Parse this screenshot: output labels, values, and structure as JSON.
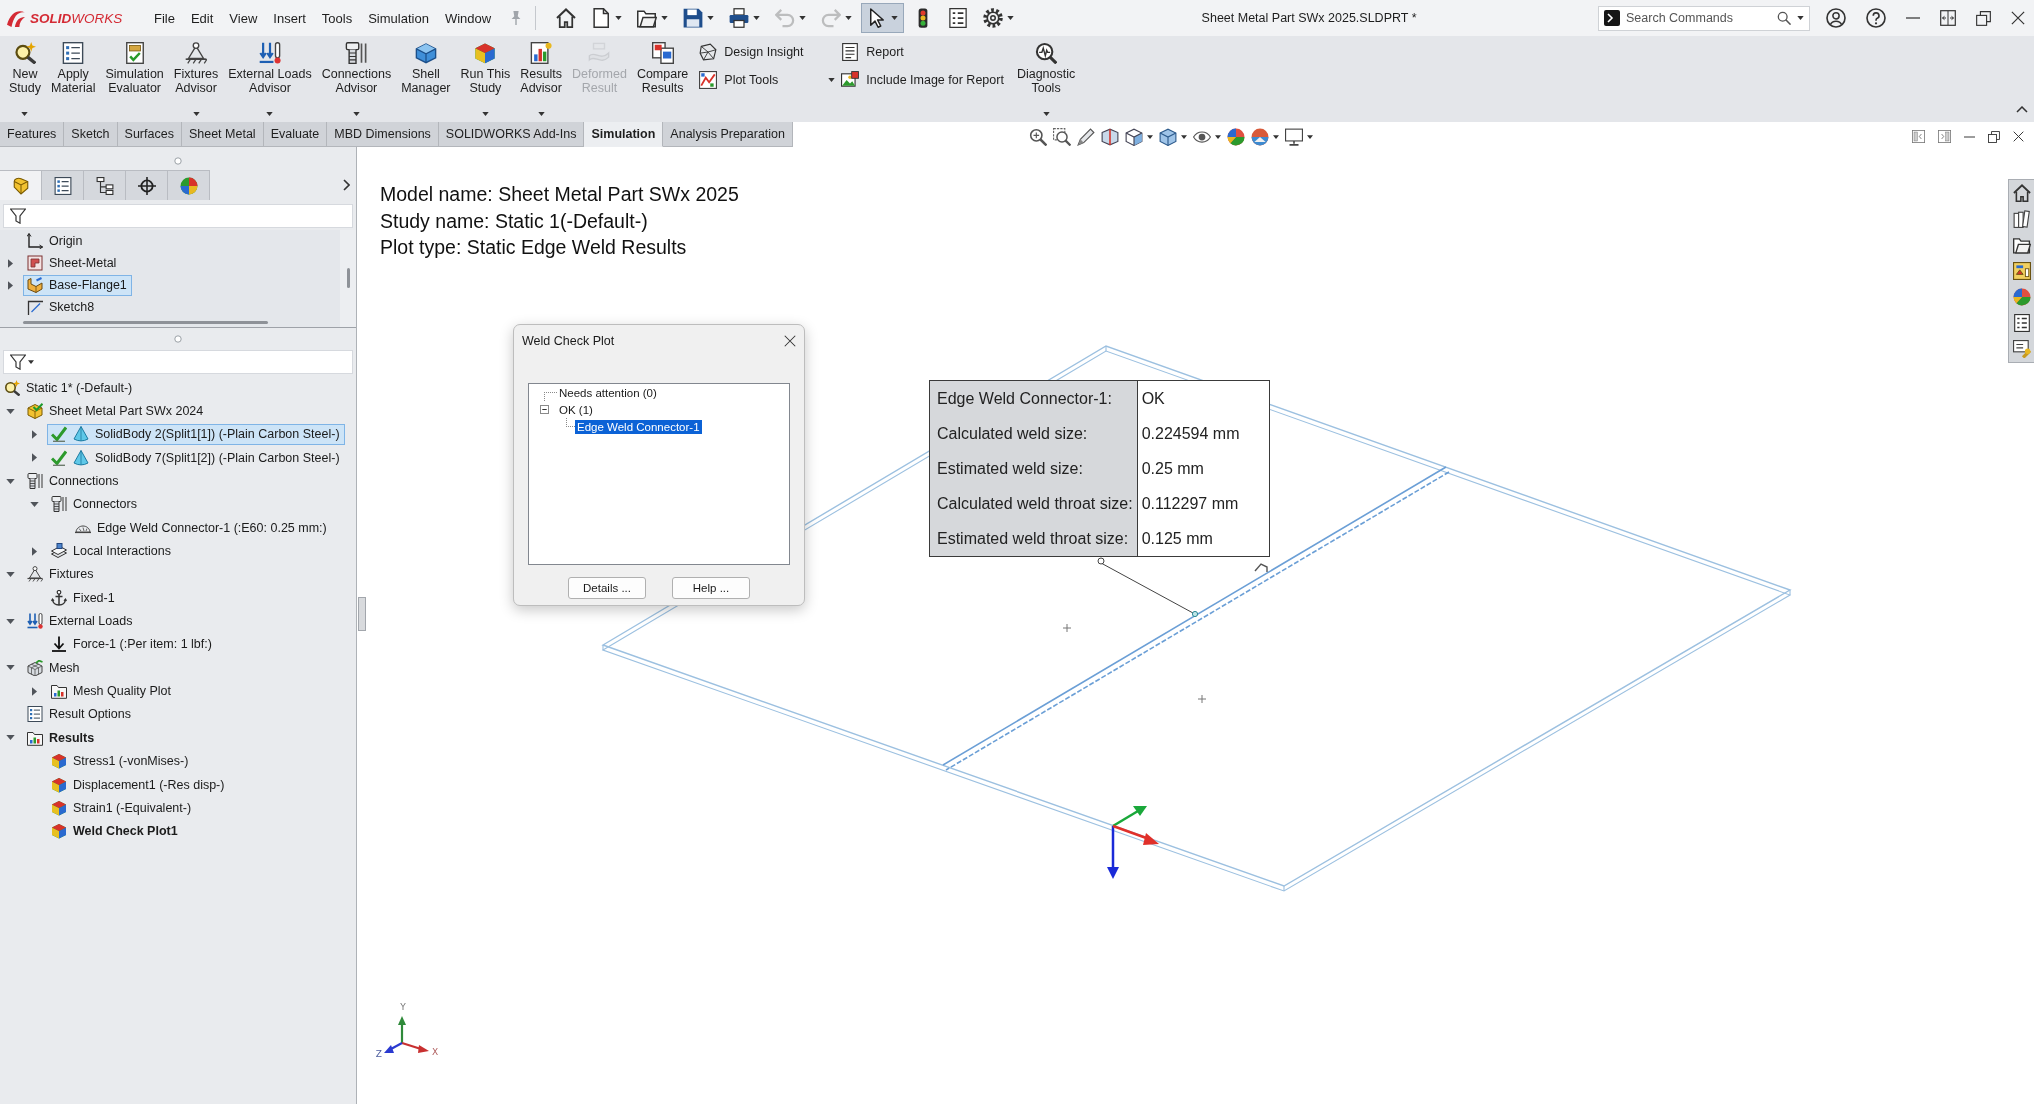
{
  "app": {
    "logo": "**SOLID**WORKS",
    "menu": [
      "File",
      "Edit",
      "View",
      "Insert",
      "Tools",
      "Simulation",
      "Window"
    ],
    "title": "Sheet Metal Part SWx 2025.SLDPRT *",
    "search": {
      "placeholder": "Search Commands"
    }
  },
  "quick_access": [
    {
      "kind": "home",
      "menu": false,
      "disabled": false,
      "pressed": false
    },
    {
      "kind": "new",
      "menu": true,
      "disabled": false,
      "pressed": false
    },
    {
      "kind": "open",
      "menu": true,
      "disabled": false,
      "pressed": false
    },
    {
      "kind": "save",
      "menu": true,
      "disabled": false,
      "pressed": false
    },
    {
      "kind": "print",
      "menu": true,
      "disabled": false,
      "pressed": false
    },
    {
      "kind": "undo",
      "menu": true,
      "disabled": true,
      "pressed": false
    },
    {
      "kind": "redo",
      "menu": true,
      "disabled": true,
      "pressed": false
    },
    {
      "kind": "select",
      "menu": true,
      "disabled": false,
      "pressed": true
    },
    {
      "kind": "rebuild",
      "menu": false,
      "disabled": false,
      "pressed": false
    },
    {
      "kind": "properties",
      "menu": false,
      "disabled": false,
      "pressed": false
    },
    {
      "kind": "options",
      "menu": true,
      "disabled": false,
      "pressed": false
    }
  ],
  "ribbon": {
    "buttons": [
      {
        "kind": "study",
        "label": "New\nStudy",
        "menu": true,
        "disabled": false
      },
      {
        "kind": "material",
        "label": "Apply\nMaterial",
        "menu": false,
        "disabled": false
      },
      {
        "kind": "evaluator",
        "label": "Simulation\nEvaluator",
        "menu": false,
        "disabled": false
      },
      {
        "kind": "fixtures",
        "label": "Fixtures\nAdvisor",
        "menu": true,
        "disabled": false
      },
      {
        "kind": "loads",
        "label": "External Loads\nAdvisor",
        "menu": true,
        "disabled": false
      },
      {
        "kind": "connections",
        "label": "Connections\nAdvisor",
        "menu": true,
        "disabled": false
      },
      {
        "kind": "shell",
        "label": "Shell\nManager",
        "menu": false,
        "disabled": false
      },
      {
        "kind": "run",
        "label": "Run This\nStudy",
        "menu": true,
        "disabled": false
      },
      {
        "kind": "results",
        "label": "Results\nAdvisor",
        "menu": true,
        "disabled": false
      },
      {
        "kind": "deformed",
        "label": "Deformed\nResult",
        "menu": false,
        "disabled": true
      },
      {
        "kind": "compare",
        "label": "Compare\nResults",
        "menu": false,
        "disabled": false
      }
    ],
    "small_buttons": [
      [
        {
          "kind": "insight",
          "label": "Design Insight",
          "menu": false
        },
        {
          "kind": "plottools",
          "label": "Plot Tools",
          "menu": true
        }
      ],
      [
        {
          "kind": "report",
          "label": "Report",
          "menu": false
        },
        {
          "kind": "image",
          "label": "Include Image for Report",
          "menu": false
        }
      ]
    ],
    "tail": [
      {
        "kind": "diagnostic",
        "label": "Diagnostic\nTools",
        "menu": true,
        "disabled": false
      }
    ]
  },
  "command_tabs": [
    {
      "label": "Features",
      "selected": false
    },
    {
      "label": "Sketch",
      "selected": false
    },
    {
      "label": "Surfaces",
      "selected": false
    },
    {
      "label": "Sheet Metal",
      "selected": false
    },
    {
      "label": "Evaluate",
      "selected": false
    },
    {
      "label": "MBD Dimensions",
      "selected": false
    },
    {
      "label": "SOLIDWORKS Add-Ins",
      "selected": false
    },
    {
      "label": "Simulation",
      "selected": true
    },
    {
      "label": "Analysis Preparation",
      "selected": false
    }
  ],
  "panel_tabs": [
    {
      "kind": "features",
      "selected": true
    },
    {
      "kind": "properties",
      "selected": false
    },
    {
      "kind": "configurations",
      "selected": false
    },
    {
      "kind": "dimxpert",
      "selected": false
    },
    {
      "kind": "display",
      "selected": false
    }
  ],
  "feature_tree": [
    {
      "kind": "origin",
      "label": "Origin",
      "selected": false
    },
    {
      "kind": "sheetmetal",
      "label": "Sheet-Metal",
      "selected": false,
      "expanded": false
    },
    {
      "kind": "flange",
      "label": "Base-Flange1",
      "selected": true,
      "expanded": false
    },
    {
      "kind": "sketch",
      "label": "Sketch8",
      "selected": false
    }
  ],
  "simulation_tree": {
    "kind": "study",
    "label": "Static 1* (-Default-)",
    "selected": false,
    "active": false,
    "children": [
      {
        "kind": "part",
        "label": "Sheet Metal Part SWx 2024",
        "selected": false,
        "active": false,
        "expanded": true,
        "children": [
          {
            "kind": "body",
            "label": "SolidBody 2(Split1[1]) (-Plain Carbon Steel-)",
            "selected": true,
            "active": false,
            "expanded": false
          },
          {
            "kind": "body",
            "label": "SolidBody 7(Split1[2]) (-Plain Carbon Steel-)",
            "selected": false,
            "active": false,
            "expanded": false
          }
        ]
      },
      {
        "kind": "connections",
        "label": "Connections",
        "selected": false,
        "active": false,
        "expanded": true,
        "children": [
          {
            "kind": "connectors",
            "label": "Connectors",
            "selected": false,
            "active": false,
            "expanded": true,
            "children": [
              {
                "kind": "weld",
                "label": "Edge Weld Connector-1 (:E60: 0.25 mm:)",
                "selected": false,
                "active": false
              }
            ]
          },
          {
            "kind": "interactions",
            "label": "Local Interactions",
            "selected": false,
            "active": false,
            "expanded": false
          }
        ]
      },
      {
        "kind": "fixtures",
        "label": "Fixtures",
        "selected": false,
        "active": false,
        "expanded": true,
        "children": [
          {
            "kind": "fixed",
            "label": "Fixed-1",
            "selected": false,
            "active": false
          }
        ]
      },
      {
        "kind": "loads",
        "label": "External Loads",
        "selected": false,
        "active": false,
        "expanded": true,
        "children": [
          {
            "kind": "force",
            "label": "Force-1 (:Per item: 1 lbf:)",
            "selected": false,
            "active": false
          }
        ]
      },
      {
        "kind": "mesh",
        "label": "Mesh",
        "selected": false,
        "active": false,
        "expanded": true,
        "children": [
          {
            "kind": "meshplot",
            "label": "Mesh Quality Plot",
            "selected": false,
            "active": false,
            "expanded": false
          }
        ]
      },
      {
        "kind": "options",
        "label": "Result Options",
        "selected": false,
        "active": false
      },
      {
        "kind": "results",
        "label": "Results",
        "selected": false,
        "active": true,
        "expanded": true,
        "children": [
          {
            "kind": "plot",
            "label": "Stress1 (-vonMises-)",
            "selected": false,
            "active": false
          },
          {
            "kind": "plot",
            "label": "Displacement1 (-Res disp-)",
            "selected": false,
            "active": false
          },
          {
            "kind": "plot",
            "label": "Strain1 (-Equivalent-)",
            "selected": false,
            "active": false
          },
          {
            "kind": "plot",
            "label": "Weld Check Plot1",
            "selected": false,
            "active": true
          }
        ]
      }
    ]
  },
  "viewport": {
    "info_lines": [
      "Model name: Sheet Metal Part SWx 2025",
      "Study name: Static 1(-Default-)",
      "Plot type: Static Edge Weld Results"
    ],
    "view_triad": {
      "y_label": "Y",
      "x_label": "X",
      "z_label": "Z"
    }
  },
  "weld_callout": {
    "rows": [
      {
        "label": "Edge Weld Connector-1:",
        "value": "OK"
      },
      {
        "label": "Calculated weld size:",
        "value": "0.224594 mm"
      },
      {
        "label": "Estimated weld size:",
        "value": "0.25 mm"
      },
      {
        "label": "Calculated weld throat size:",
        "value": "0.112297 mm"
      },
      {
        "label": "Estimated weld throat size:",
        "value": "0.125 mm"
      }
    ]
  },
  "weld_dialog": {
    "title": "Weld Check Plot",
    "tree": [
      {
        "label": "Needs attention (0)",
        "selected": false
      },
      {
        "label": "OK (1)",
        "selected": false,
        "expanded": true,
        "children": [
          {
            "label": "Edge Weld Connector-1",
            "selected": true
          }
        ]
      }
    ],
    "buttons": [
      "Details ...",
      "Help ..."
    ]
  }
}
